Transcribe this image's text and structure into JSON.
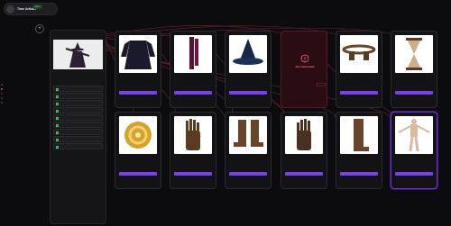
{
  "app": {
    "subtitle": "",
    "title": "Time Artister",
    "status": "Agent"
  },
  "canvas": {
    "add_label": "+"
  },
  "side_panel": {
    "header": "",
    "section_title": "",
    "rows": [
      "",
      "",
      "",
      "",
      "",
      "",
      "",
      "",
      ""
    ]
  },
  "accent": "#7a3ff0",
  "error_color": "#ff6a7a",
  "cards": [
    {
      "id": "robe",
      "caption": "",
      "sub": "",
      "button": "",
      "icon": "robe-icon"
    },
    {
      "id": "scarf",
      "caption": "",
      "sub": "",
      "button": "",
      "icon": "scarf-icon"
    },
    {
      "id": "hat",
      "caption": "",
      "sub": "",
      "button": "",
      "icon": "wizard-hat-icon"
    },
    {
      "id": "error",
      "caption": "Not Generated",
      "sub": "",
      "button": "",
      "icon": "error-icon"
    },
    {
      "id": "belt",
      "caption": "",
      "sub": "",
      "button": "",
      "icon": "belt-icon"
    },
    {
      "id": "hourglass",
      "caption": "",
      "sub": "",
      "button": "",
      "icon": "hourglass-icon"
    },
    {
      "id": "orb",
      "caption": "",
      "sub": "",
      "button": "",
      "icon": "orb-icon"
    },
    {
      "id": "glove-r",
      "caption": "",
      "sub": "",
      "button": "",
      "icon": "glove-icon"
    },
    {
      "id": "boots",
      "caption": "",
      "sub": "",
      "button": "",
      "icon": "boots-icon"
    },
    {
      "id": "glove-l",
      "caption": "",
      "sub": "",
      "button": "",
      "icon": "glove-icon"
    },
    {
      "id": "boot-l",
      "caption": "",
      "sub": "",
      "button": "",
      "icon": "boot-icon"
    },
    {
      "id": "body",
      "caption": "",
      "sub": "",
      "button": "",
      "icon": "body-icon"
    }
  ]
}
